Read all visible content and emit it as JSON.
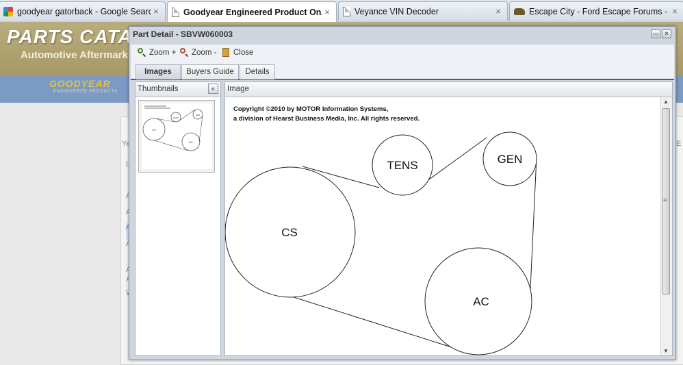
{
  "browser": {
    "tabs": [
      {
        "title": "goodyear gatorback - Google Search",
        "icon": "google-icon",
        "close": "×"
      },
      {
        "title": "Goodyear Engineered Product On...",
        "icon": "page-icon",
        "close": "×"
      },
      {
        "title": "Veyance VIN Decoder",
        "icon": "page-icon",
        "close": "×"
      },
      {
        "title": "Escape City - Ford Escape Forums - ...",
        "icon": "car-icon",
        "close": "×"
      }
    ]
  },
  "site": {
    "title": "PARTS CATA",
    "subtitle": "Automotive Aftermarke",
    "logo": "GOODYEAR",
    "logo_sub": "ENGINEERED PRODUCTS",
    "side_letters": [
      "Ye",
      "L",
      "A",
      "A",
      "A",
      "A",
      "A",
      "A",
      "W"
    ],
    "right_letter": "E"
  },
  "dialog": {
    "title": "Part Detail - SBVW060003",
    "restore_glyph": "▭",
    "close_glyph": "✕",
    "toolbar": {
      "zoom_in": "Zoom +",
      "zoom_out": "Zoom -",
      "close": "Close"
    },
    "tabs": [
      "Images",
      "Buyers Guide",
      "Details"
    ],
    "thumbnails_header": "Thumbnails",
    "collapse_glyph": "«",
    "image_header": "Image",
    "copyright_line1": "Copyright ©2010 by MOTOR Information Systems,",
    "copyright_line2": "a division of Hearst Business Media, Inc. All rights reserved.",
    "pulleys": {
      "cs": "CS",
      "tens": "TENS",
      "gen": "GEN",
      "ac": "AC"
    },
    "thumb_pulleys": {
      "cs": "CS",
      "tens": "TENS",
      "gen": "GEN",
      "ac": "AC"
    },
    "scroll_up": "▲",
    "scroll_down": "▼",
    "scroll_grip": "≡"
  }
}
